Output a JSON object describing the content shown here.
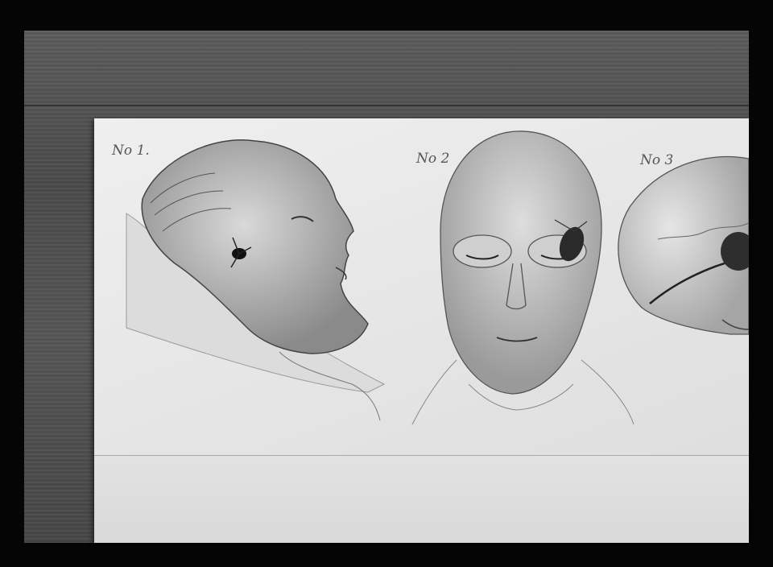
{
  "figure": {
    "labels": [
      "No 1.",
      "No 2",
      "No 3"
    ]
  },
  "colors": {
    "wood": "#555555",
    "paper": "#e8e8e8",
    "pencil": "#3a3a3a",
    "frame": "#050505"
  }
}
